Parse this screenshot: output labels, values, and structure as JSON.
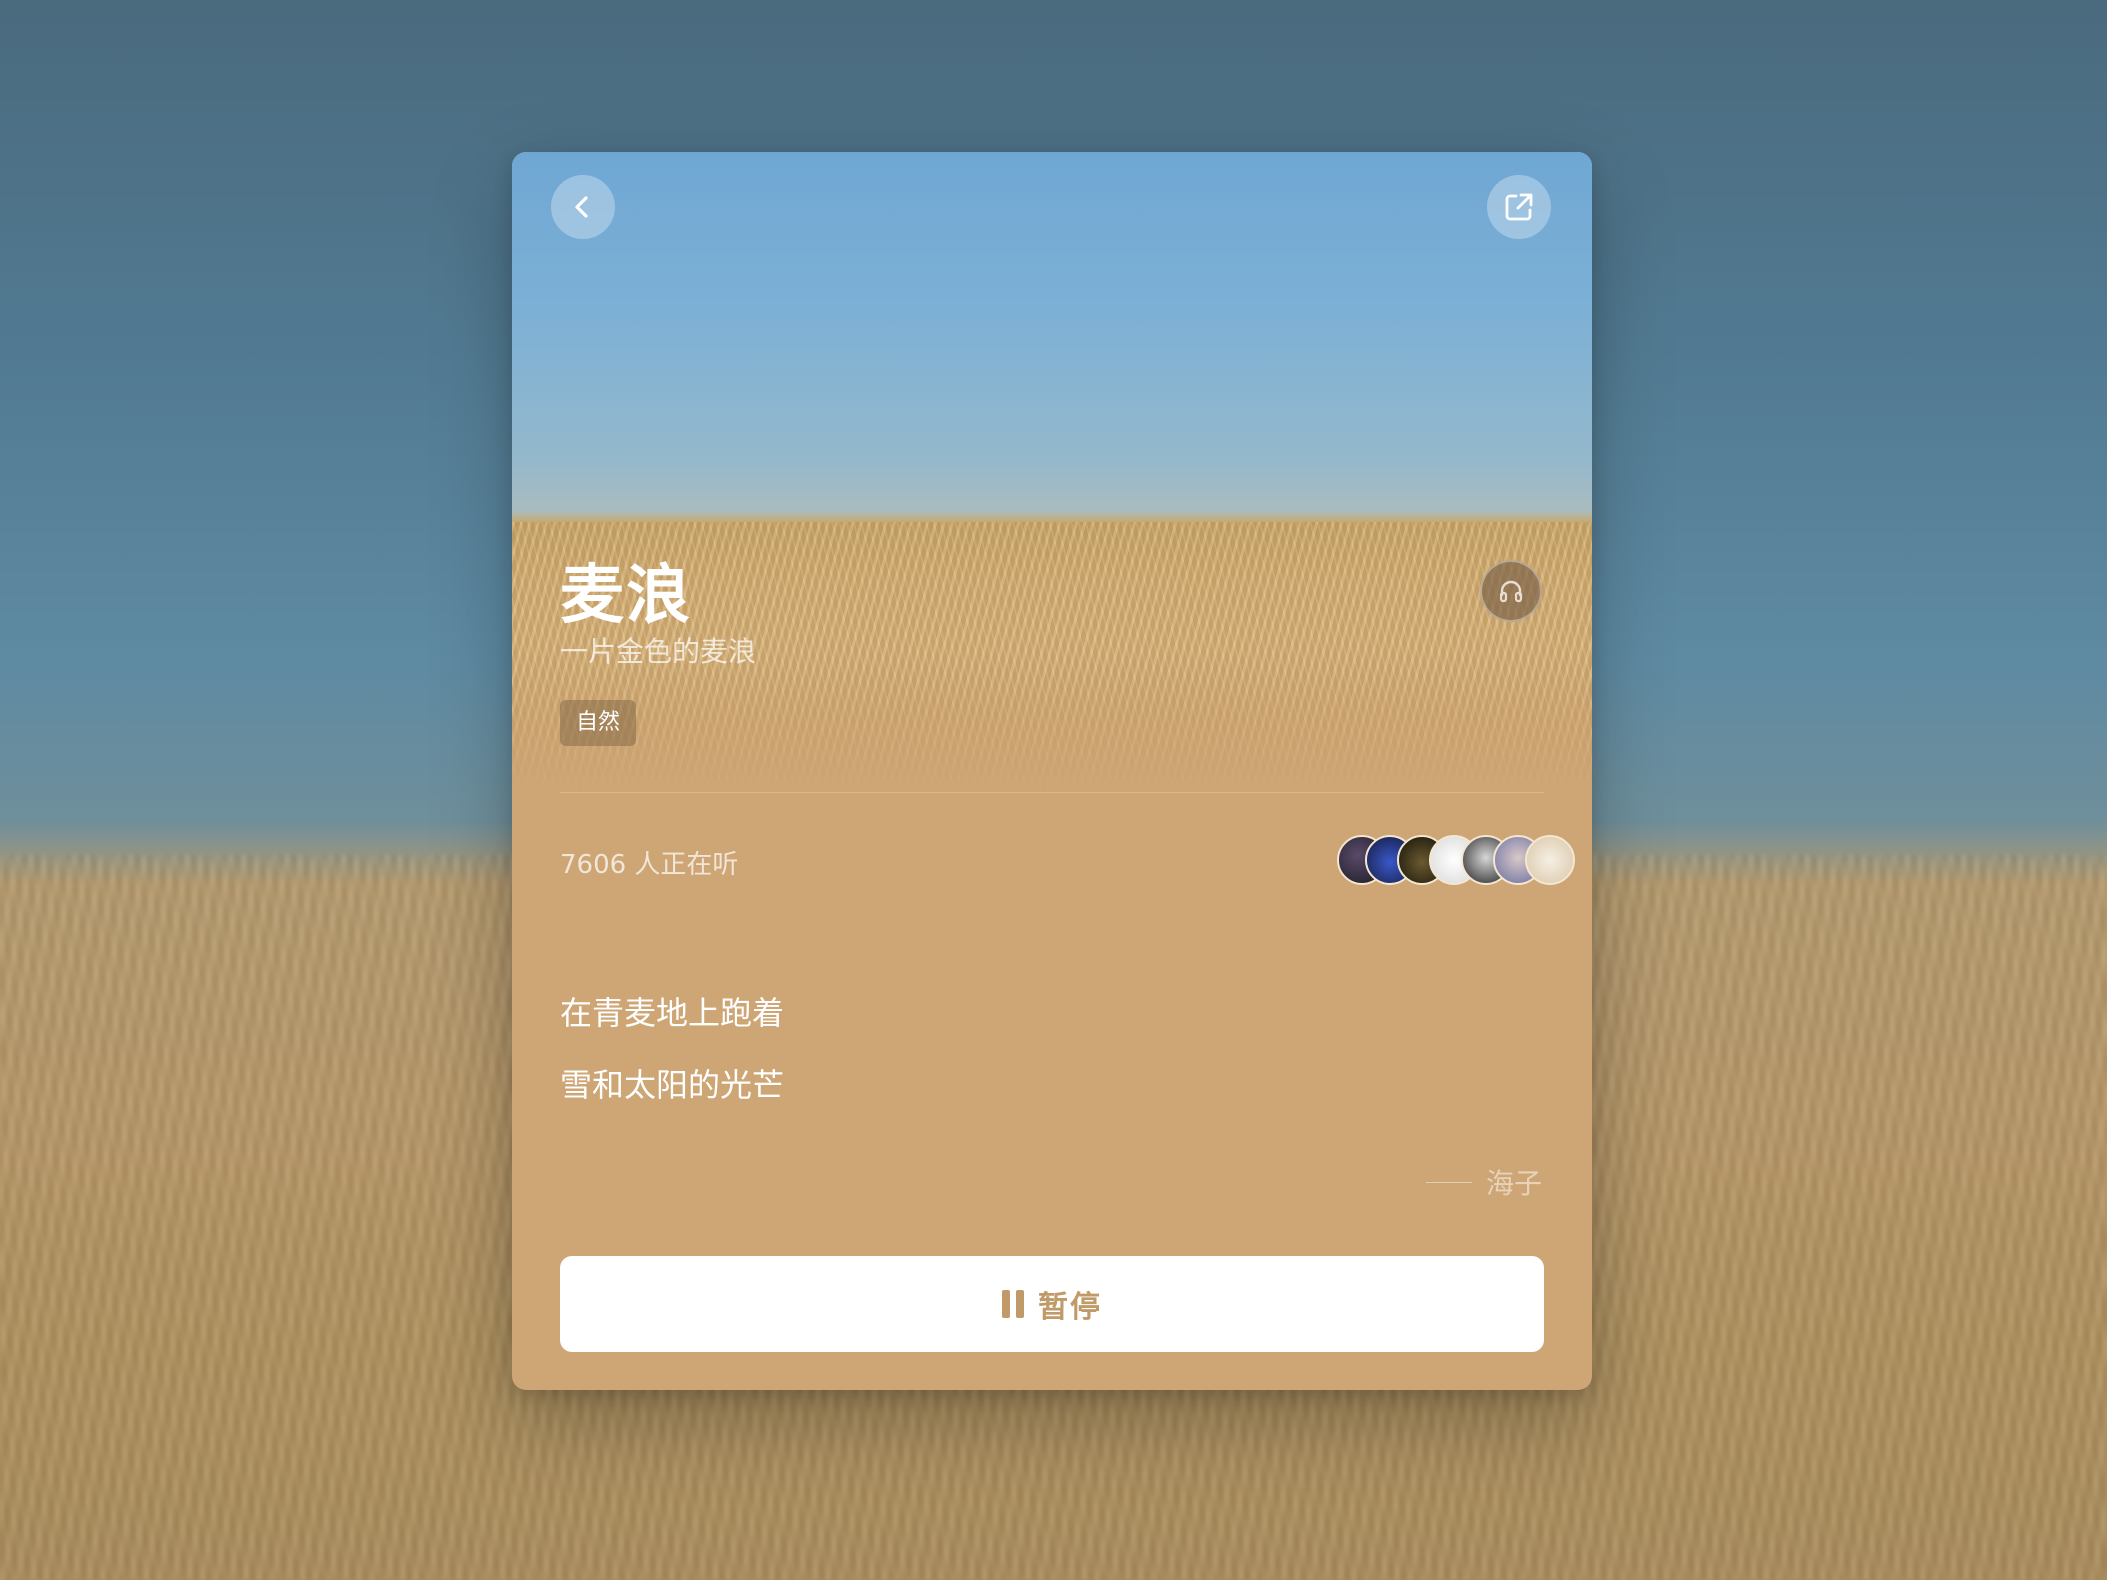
{
  "card": {
    "title": "麦浪",
    "subtitle": "一片金色的麦浪",
    "tag": "自然",
    "listeners": "7606 人正在听",
    "poem": [
      "在青麦地上跑着",
      "雪和太阳的光芒"
    ],
    "author": "海子",
    "pause_label": "暂停"
  },
  "icons": {
    "back": "chevron-left-icon",
    "share": "share-external-icon",
    "listen": "headphones-icon",
    "pause": "pause-icon"
  },
  "avatars": [
    {
      "name": "avatar-1",
      "color": "#2b2b35"
    },
    {
      "name": "avatar-2",
      "color": "#1e2a5c"
    },
    {
      "name": "avatar-3",
      "color": "#2a2416"
    },
    {
      "name": "avatar-4",
      "color": "#efefef"
    },
    {
      "name": "avatar-5",
      "color": "#3a3a3a"
    },
    {
      "name": "avatar-6",
      "color": "#8a8fb4"
    },
    {
      "name": "avatar-7",
      "color": "#e9dcc6"
    }
  ],
  "colors": {
    "card_bg": "#cea574",
    "accent": "#c09a69"
  }
}
